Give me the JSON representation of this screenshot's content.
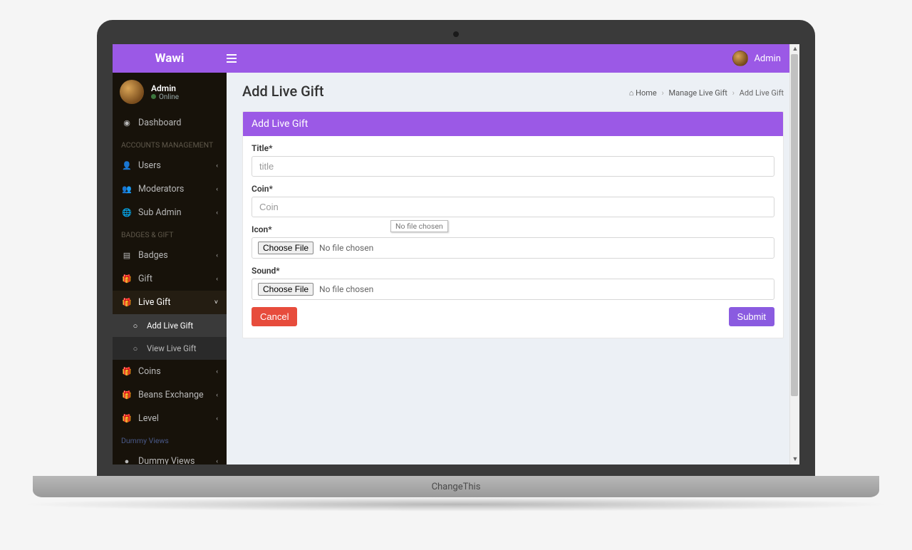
{
  "brand": "Wawi",
  "top_user": "Admin",
  "sidebar": {
    "user": {
      "name": "Admin",
      "status": "Online"
    },
    "dashboard": "Dashboard",
    "headers": {
      "accounts": "ACCOUNTS MANAGEMENT",
      "badges": "BADGES & GIFT",
      "dummy": "Dummy Views"
    },
    "items": {
      "users": "Users",
      "moderators": "Moderators",
      "subadmin": "Sub Admin",
      "badges": "Badges",
      "gift": "Gift",
      "livegift": "Live Gift",
      "coins": "Coins",
      "beans": "Beans Exchange",
      "level": "Level",
      "dummyviews": "Dummy Views"
    },
    "sub": {
      "add": "Add Live Gift",
      "view": "View Live Gift"
    }
  },
  "page": {
    "title": "Add Live Gift",
    "breadcrumb": {
      "home": "Home",
      "mid": "Manage Live Gift",
      "last": "Add Live Gift"
    },
    "panel_title": "Add Live Gift"
  },
  "form": {
    "title_label": "Title*",
    "title_placeholder": "title",
    "coin_label": "Coin*",
    "coin_placeholder": "Coin",
    "icon_label": "Icon*",
    "sound_label": "Sound*",
    "choose_file": "Choose File",
    "no_file": "No file chosen",
    "cancel": "Cancel",
    "submit": "Submit",
    "tooltip": "No file chosen"
  },
  "laptop_label": "ChangeThis"
}
